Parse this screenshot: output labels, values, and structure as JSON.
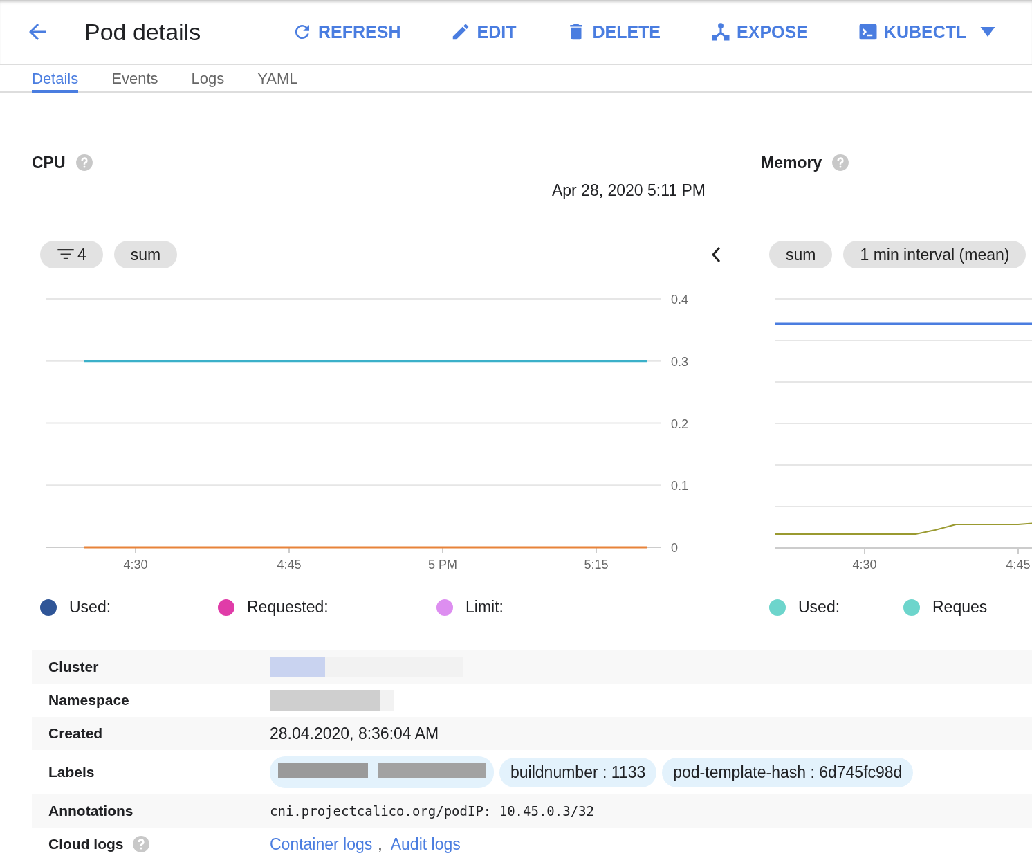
{
  "header": {
    "title": "Pod details",
    "actions": [
      {
        "kind": "refresh",
        "label": "REFRESH"
      },
      {
        "kind": "edit",
        "label": "EDIT"
      },
      {
        "kind": "delete",
        "label": "DELETE"
      },
      {
        "kind": "expose",
        "label": "EXPOSE"
      },
      {
        "kind": "kubectl",
        "label": "KUBECTL"
      }
    ]
  },
  "tabs": [
    {
      "label": "Details",
      "selected": true
    },
    {
      "label": "Events",
      "selected": false
    },
    {
      "label": "Logs",
      "selected": false
    },
    {
      "label": "YAML",
      "selected": false
    }
  ],
  "cpu": {
    "title": "CPU",
    "timestamp": "Apr 28, 2020 5:11 PM",
    "chips": [
      {
        "kind": "filter",
        "label": "4"
      },
      {
        "kind": "plain",
        "label": "sum"
      }
    ],
    "chart_data": {
      "type": "line",
      "categories": [
        null,
        null,
        "4:30",
        null,
        null,
        "4:45",
        null,
        null,
        "5 PM",
        null,
        null,
        "5:15",
        null
      ],
      "series": [
        {
          "color": "#3bb0c9",
          "values": [
            null,
            0.3,
            0.3,
            0.3,
            0.3,
            0.3,
            0.3,
            0.3,
            0.3,
            0.3,
            0.3,
            0.3,
            0.3
          ]
        },
        {
          "color": "#e8833a",
          "values": [
            null,
            0,
            0,
            0,
            0,
            0,
            0,
            0,
            0,
            0,
            0,
            0,
            0
          ]
        }
      ],
      "ylim": [
        0,
        0.4
      ],
      "grid": true,
      "yticks": [
        {
          "value": 0,
          "label": "0"
        },
        {
          "value": 0.1,
          "label": "0.1"
        },
        {
          "value": 0.2,
          "label": "0.2"
        },
        {
          "value": 0.3,
          "label": "0.3"
        },
        {
          "value": 0.4,
          "label": "0.4"
        }
      ]
    },
    "legend": [
      {
        "label": "Used:",
        "color": "#2f5597"
      },
      {
        "label": "Requested:",
        "color": "#e03ca8"
      },
      {
        "label": "Limit:",
        "color": "#dd8ef0"
      }
    ]
  },
  "memory": {
    "title": "Memory",
    "chips": [
      {
        "label": "sum"
      },
      {
        "label": "1 min interval (mean)"
      }
    ],
    "xtick_labels": [
      "4:30",
      "4:45"
    ],
    "legend": [
      {
        "label": "Used:",
        "color": "#6dd5cc"
      },
      {
        "label": "Reques",
        "color": "#6dd5cc"
      }
    ]
  },
  "details": [
    {
      "kind": "blurred",
      "label": "Cluster"
    },
    {
      "kind": "blurred",
      "label": "Namespace"
    },
    {
      "kind": "text",
      "label": "Created",
      "value": "28.04.2020, 8:36:04 AM"
    },
    {
      "kind": "labels",
      "label": "Labels",
      "chips": [
        "buildnumber : 1133",
        "pod-template-hash : 6d745fc98d"
      ]
    },
    {
      "kind": "mono",
      "label": "Annotations",
      "value": "cni.projectcalico.org/podIP: 10.45.0.3/32"
    },
    {
      "kind": "links",
      "label": "Cloud logs",
      "help": true,
      "links": [
        "Container logs",
        "Audit logs"
      ],
      "separator": ","
    }
  ]
}
